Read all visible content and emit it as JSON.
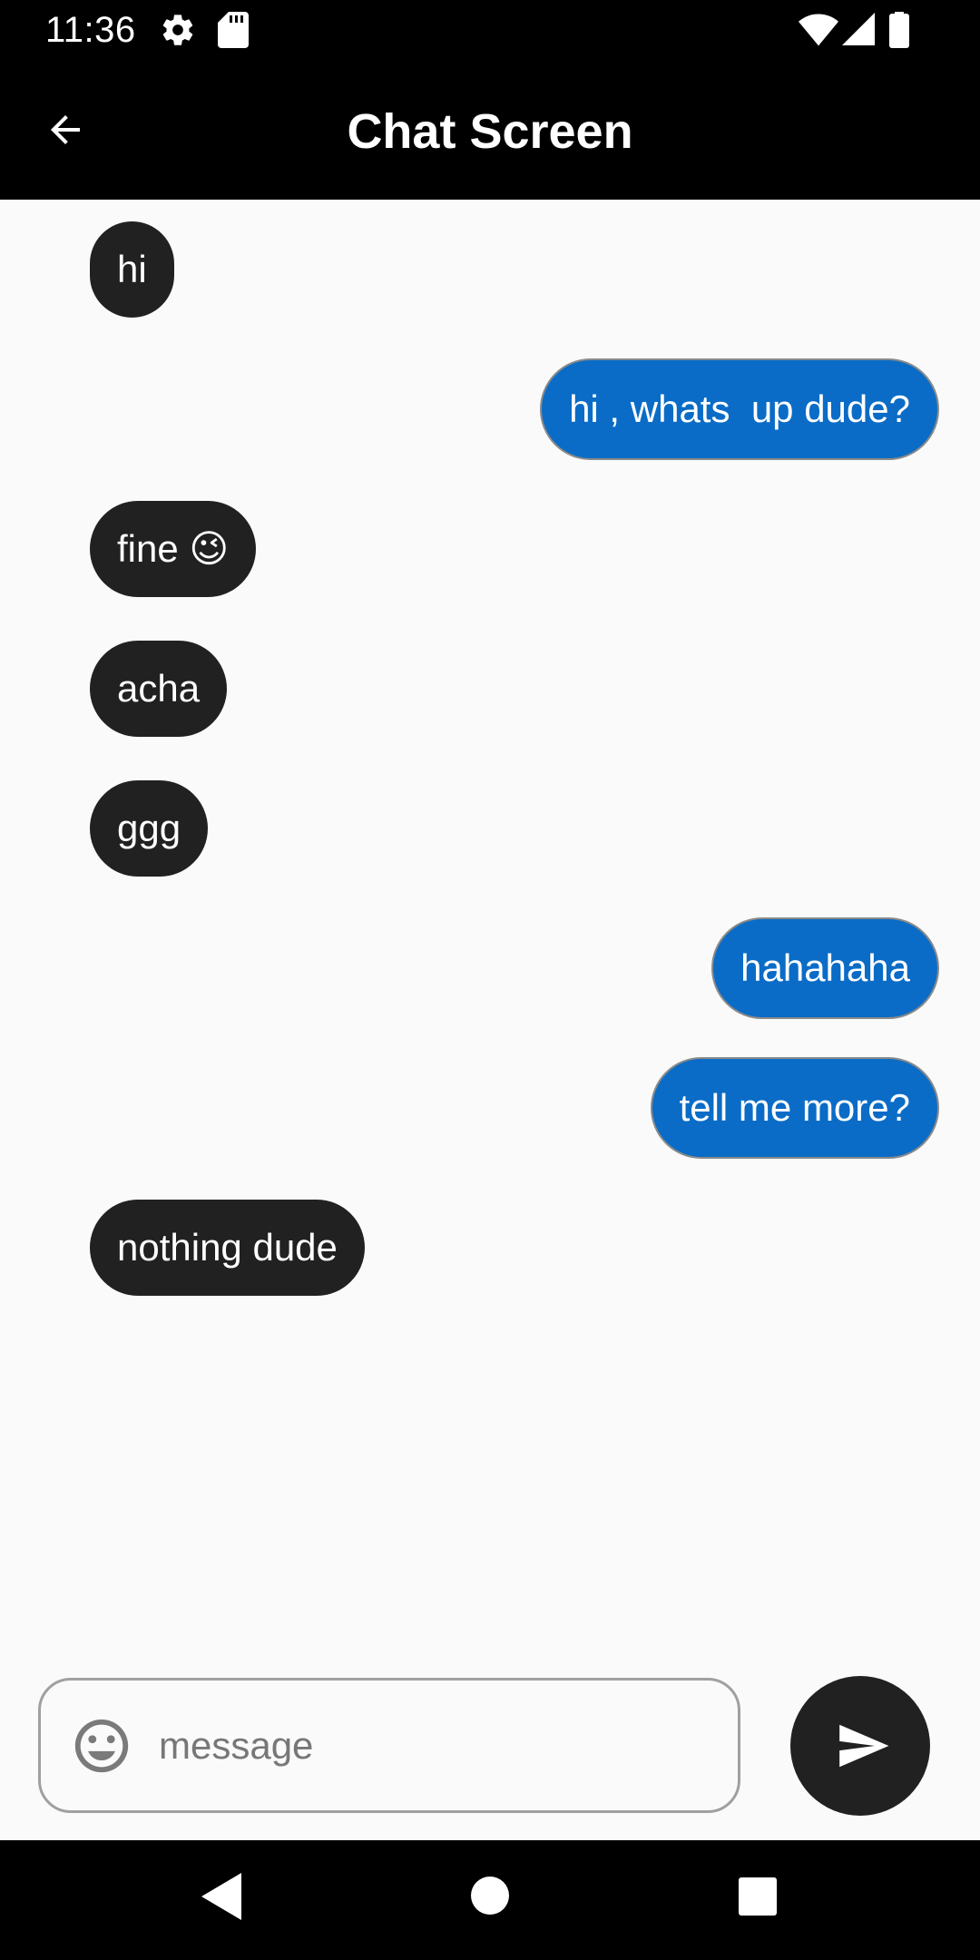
{
  "status_bar": {
    "time": "11:36",
    "icons": [
      "gear-icon",
      "sd-card-icon",
      "wifi-icon",
      "signal-icon",
      "battery-icon"
    ]
  },
  "app_bar": {
    "title": "Chat Screen",
    "back_icon": "arrow-back-icon"
  },
  "messages": [
    {
      "text": "hi",
      "direction": "received"
    },
    {
      "text": "hi , whats  up dude?",
      "direction": "sent"
    },
    {
      "text": "fine 😉",
      "direction": "received"
    },
    {
      "text": "acha",
      "direction": "received"
    },
    {
      "text": "ggg",
      "direction": "received"
    },
    {
      "text": "hahahaha",
      "direction": "sent"
    },
    {
      "text": "tell me more?",
      "direction": "sent"
    },
    {
      "text": "nothing dude",
      "direction": "received"
    }
  ],
  "composer": {
    "placeholder": "message",
    "value": "",
    "emoji_icon": "emoji-icon",
    "send_icon": "send-icon"
  },
  "nav_bar": {
    "icons": [
      "nav-back-icon",
      "nav-home-icon",
      "nav-recents-icon"
    ]
  },
  "colors": {
    "bar_background": "#000000",
    "received_bubble": "#212121",
    "sent_bubble": "#0a6cc6",
    "screen_background": "#fafafa"
  }
}
